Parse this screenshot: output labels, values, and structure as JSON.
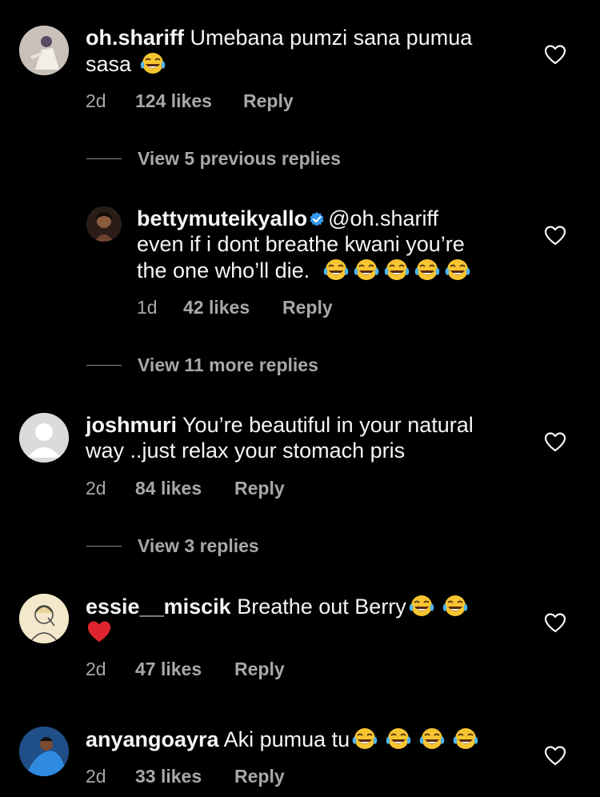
{
  "colors": {
    "background": "#000000",
    "text": "#f5f5f5",
    "muted": "#a8a8a8",
    "verified": "#3897f0",
    "heart": "#e0242f"
  },
  "comments": [
    {
      "username": "oh.shariff",
      "text_line1": "Umebana pumzi sana pumua",
      "text_line2": "sasa",
      "time": "2d",
      "likes": "124 likes",
      "reply": "Reply"
    },
    {
      "username": "bettymuteikyallo",
      "mention": "@oh.shariff",
      "text_line1": "even if i dont breathe kwani you’re",
      "text_line2": "the one who’ll die.",
      "time": "1d",
      "likes": "42 likes",
      "reply": "Reply"
    },
    {
      "username": "joshmuri",
      "text_line1": "You’re beautiful in your natural",
      "text_line2": "way ..just relax your stomach pris",
      "time": "2d",
      "likes": "84 likes",
      "reply": "Reply"
    },
    {
      "username": "essie__miscik",
      "text_line1": "Breathe out Berry",
      "time": "2d",
      "likes": "47 likes",
      "reply": "Reply"
    },
    {
      "username": "anyangoayra",
      "text_line1": "Aki pumua tu",
      "time": "2d",
      "likes": "33 likes",
      "reply": "Reply"
    }
  ],
  "view_replies": [
    "View 5 previous replies",
    "View 11 more replies",
    "View 3 replies"
  ],
  "icons": {
    "like": "heart-outline-icon",
    "verified": "verified-badge-icon",
    "laugh": "tears-of-joy-emoji",
    "red_heart": "red-heart-emoji"
  }
}
